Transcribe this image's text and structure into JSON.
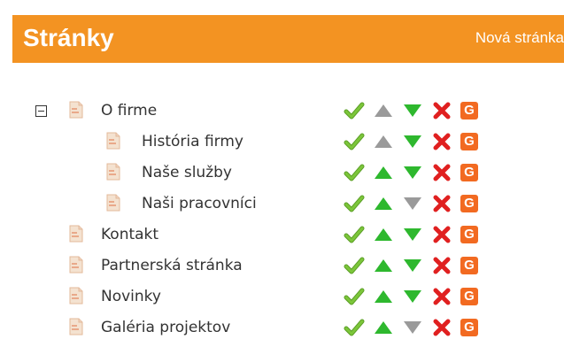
{
  "header": {
    "title": "Stránky",
    "new_page_link": "Nová stránka",
    "background": "#f39322"
  },
  "pages": [
    {
      "label": "O firme",
      "level": 0,
      "collapsible": true,
      "up_enabled": false,
      "down_enabled": true
    },
    {
      "label": "História firmy",
      "level": 1,
      "collapsible": false,
      "up_enabled": false,
      "down_enabled": true
    },
    {
      "label": "Naše služby",
      "level": 1,
      "collapsible": false,
      "up_enabled": true,
      "down_enabled": true
    },
    {
      "label": "Naši pracovníci",
      "level": 1,
      "collapsible": false,
      "up_enabled": true,
      "down_enabled": false
    },
    {
      "label": "Kontakt",
      "level": 0,
      "collapsible": false,
      "up_enabled": true,
      "down_enabled": true
    },
    {
      "label": "Partnerská stránka",
      "level": 0,
      "collapsible": false,
      "up_enabled": true,
      "down_enabled": true
    },
    {
      "label": "Novinky",
      "level": 0,
      "collapsible": false,
      "up_enabled": true,
      "down_enabled": true
    },
    {
      "label": "Galéria projektov",
      "level": 0,
      "collapsible": false,
      "up_enabled": true,
      "down_enabled": false
    }
  ],
  "action_icons": {
    "publish": "checkmark-icon",
    "move_up": "arrow-up-icon",
    "move_down": "arrow-down-icon",
    "delete": "delete-icon",
    "google": "google-icon",
    "google_letter": "G"
  },
  "colors": {
    "enabled_arrow": "#2eb82e",
    "disabled_arrow": "#9a9a9a",
    "check": "#7cc63a",
    "delete": "#e02020",
    "google_badge": "#f26a21"
  }
}
